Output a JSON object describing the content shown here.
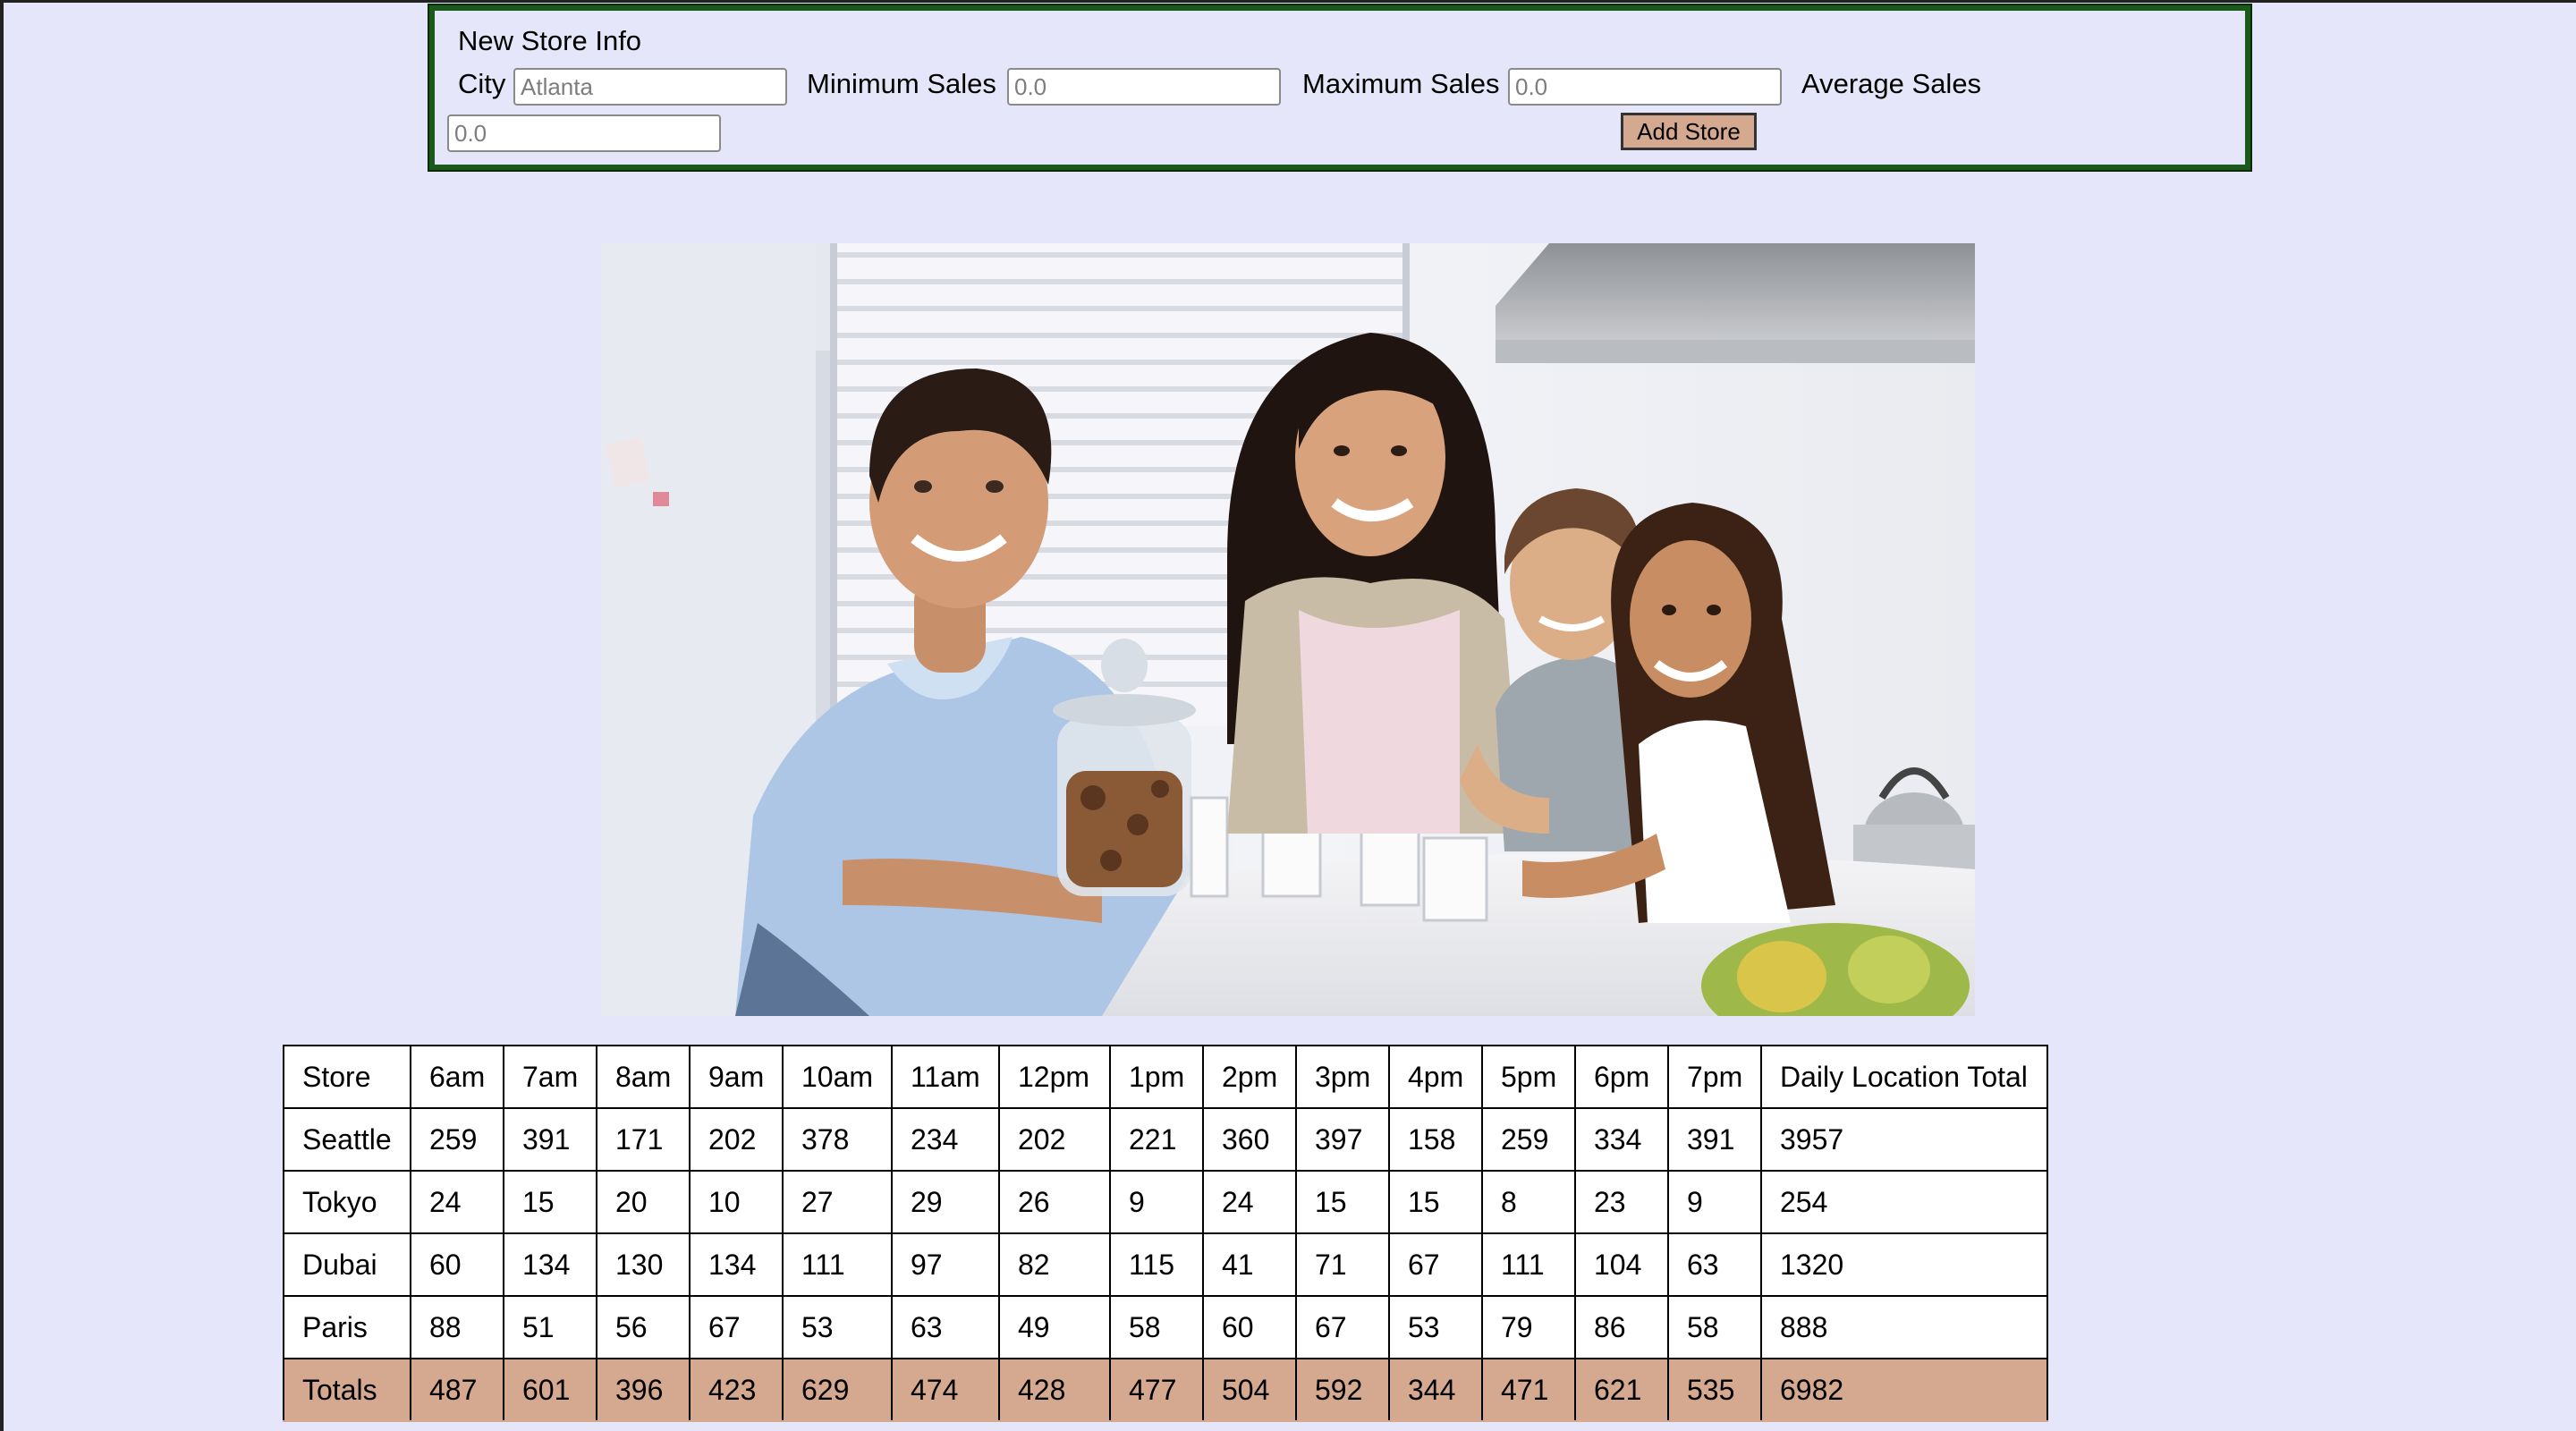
{
  "form": {
    "title": "New Store Info",
    "city_label": "City",
    "city_placeholder": "Atlanta",
    "min_label": "Minimum Sales",
    "min_placeholder": "0.0",
    "max_label": "Maximum Sales",
    "max_placeholder": "0.0",
    "avg_label": "Average Sales",
    "avg_placeholder": "0.0",
    "submit_label": "Add Store"
  },
  "photo": {
    "alt": "family"
  },
  "table": {
    "headers": [
      "Store",
      "6am",
      "7am",
      "8am",
      "9am",
      "10am",
      "11am",
      "12pm",
      "1pm",
      "2pm",
      "3pm",
      "4pm",
      "5pm",
      "6pm",
      "7pm",
      "Daily Location Total"
    ],
    "rows": [
      [
        "Seattle",
        "259",
        "391",
        "171",
        "202",
        "378",
        "234",
        "202",
        "221",
        "360",
        "397",
        "158",
        "259",
        "334",
        "391",
        "3957"
      ],
      [
        "Tokyo",
        "24",
        "15",
        "20",
        "10",
        "27",
        "29",
        "26",
        "9",
        "24",
        "15",
        "15",
        "8",
        "23",
        "9",
        "254"
      ],
      [
        "Dubai",
        "60",
        "134",
        "130",
        "134",
        "111",
        "97",
        "82",
        "115",
        "41",
        "71",
        "67",
        "111",
        "104",
        "63",
        "1320"
      ],
      [
        "Paris",
        "88",
        "51",
        "56",
        "67",
        "53",
        "63",
        "49",
        "58",
        "60",
        "67",
        "53",
        "79",
        "86",
        "58",
        "888"
      ]
    ],
    "totals": [
      "Totals",
      "487",
      "601",
      "396",
      "423",
      "629",
      "474",
      "428",
      "477",
      "504",
      "592",
      "344",
      "471",
      "621",
      "535",
      "6982"
    ]
  },
  "colors": {
    "page_background": "#e6e6fa",
    "form_border": "#1c5a1c",
    "accent": "#d5a990"
  }
}
